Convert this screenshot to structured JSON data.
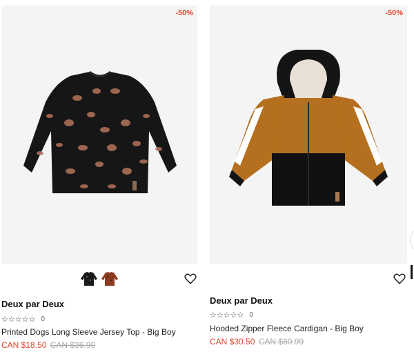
{
  "products": [
    {
      "discount": "-50%",
      "brand": "Deux par Deux",
      "rating_count": "0",
      "name": "Printed Dogs Long Sleeve Jersey Top - Big Boy",
      "sale_price": "CAN $18.50",
      "original_price": "CAN $36.99",
      "swatches": [
        "#1a1a1a",
        "#8a3b22"
      ]
    },
    {
      "discount": "-50%",
      "brand": "Deux par Deux",
      "rating_count": "0",
      "name": "Hooded Zipper Fleece Cardigan - Big Boy",
      "sale_price": "CAN $30.50",
      "original_price": "CAN $60.99"
    }
  ],
  "colors": {
    "accent": "#e0452a",
    "strike": "#aaaaaa",
    "image_bg": "#f4f4f4"
  },
  "icons": {
    "wishlist": "heart-outline-icon",
    "rating": "star-outline-icon"
  }
}
